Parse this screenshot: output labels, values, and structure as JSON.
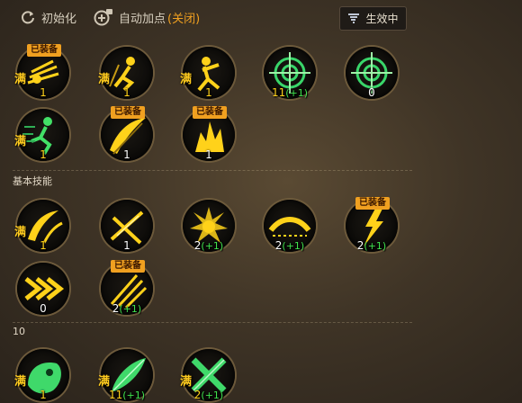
{
  "toolbar": {
    "reset_label": "初始化",
    "auto_label": "自动加点",
    "auto_state": "(关闭)",
    "effect_label": "生效中"
  },
  "sections": [
    {
      "title": "基本技能"
    },
    {
      "title": "10"
    }
  ],
  "max_text": "满",
  "equipped_text": "已装备",
  "skills": [
    {
      "id": "s1",
      "level": "1",
      "bonus": "",
      "maxed": true,
      "equipped": true,
      "icon": "crawl-dash-icon",
      "level_color": "#ffd21a"
    },
    {
      "id": "s2",
      "level": "1",
      "bonus": "",
      "maxed": true,
      "equipped": false,
      "icon": "crouch-figure-icon",
      "level_color": "#ffd21a"
    },
    {
      "id": "s3",
      "level": "1",
      "bonus": "",
      "maxed": true,
      "equipped": false,
      "icon": "fighter-icon",
      "level_color": "#ffd21a"
    },
    {
      "id": "s4",
      "level": "11",
      "bonus": "(+1)",
      "maxed": false,
      "equipped": false,
      "icon": "crosshair-icon",
      "level_color": "#ffd21a"
    },
    {
      "id": "s5",
      "level": "0",
      "bonus": "",
      "maxed": false,
      "equipped": false,
      "icon": "crosshair-icon",
      "level_color": "#ffffff"
    },
    {
      "id": "s6",
      "level": "1",
      "bonus": "",
      "maxed": true,
      "equipped": false,
      "icon": "sprint-icon",
      "level_color": "#ffd21a"
    },
    {
      "id": "s7",
      "level": "1",
      "bonus": "",
      "maxed": false,
      "equipped": true,
      "icon": "slash-icon",
      "level_color": "#ffffff"
    },
    {
      "id": "s8",
      "level": "1",
      "bonus": "",
      "maxed": false,
      "equipped": true,
      "icon": "burst-icon",
      "level_color": "#ffffff"
    },
    {
      "id": "s9",
      "level": "1",
      "bonus": "",
      "maxed": true,
      "equipped": false,
      "icon": "crescent-slash-icon",
      "level_color": "#ffd21a"
    },
    {
      "id": "s10",
      "level": "1",
      "bonus": "",
      "maxed": false,
      "equipped": false,
      "icon": "cross-slash-icon",
      "level_color": "#ffffff"
    },
    {
      "id": "s11",
      "level": "2",
      "bonus": "(+1)",
      "maxed": false,
      "equipped": false,
      "icon": "flame-burst-icon",
      "level_color": "#ffffff"
    },
    {
      "id": "s12",
      "level": "2",
      "bonus": "(+1)",
      "maxed": false,
      "equipped": false,
      "icon": "wave-slash-icon",
      "level_color": "#ffffff"
    },
    {
      "id": "s13",
      "level": "2",
      "bonus": "(+1)",
      "maxed": false,
      "equipped": true,
      "icon": "lightning-icon",
      "level_color": "#ffffff"
    },
    {
      "id": "s14",
      "level": "0",
      "bonus": "",
      "maxed": false,
      "equipped": false,
      "icon": "chevrons-icon",
      "level_color": "#ffffff"
    },
    {
      "id": "s15",
      "level": "2",
      "bonus": "(+1)",
      "maxed": false,
      "equipped": true,
      "icon": "triple-slash-icon",
      "level_color": "#ffffff"
    },
    {
      "id": "s16",
      "level": "1",
      "bonus": "",
      "maxed": true,
      "equipped": false,
      "icon": "beast-icon",
      "level_color": "#ffd21a"
    },
    {
      "id": "s17",
      "level": "11",
      "bonus": "(+1)",
      "maxed": true,
      "equipped": false,
      "icon": "leaf-blade-icon",
      "level_color": "#ffd21a"
    },
    {
      "id": "s18",
      "level": "2",
      "bonus": "(+1)",
      "maxed": true,
      "equipped": false,
      "icon": "cross-blade-icon",
      "level_color": "#ffd21a"
    }
  ]
}
